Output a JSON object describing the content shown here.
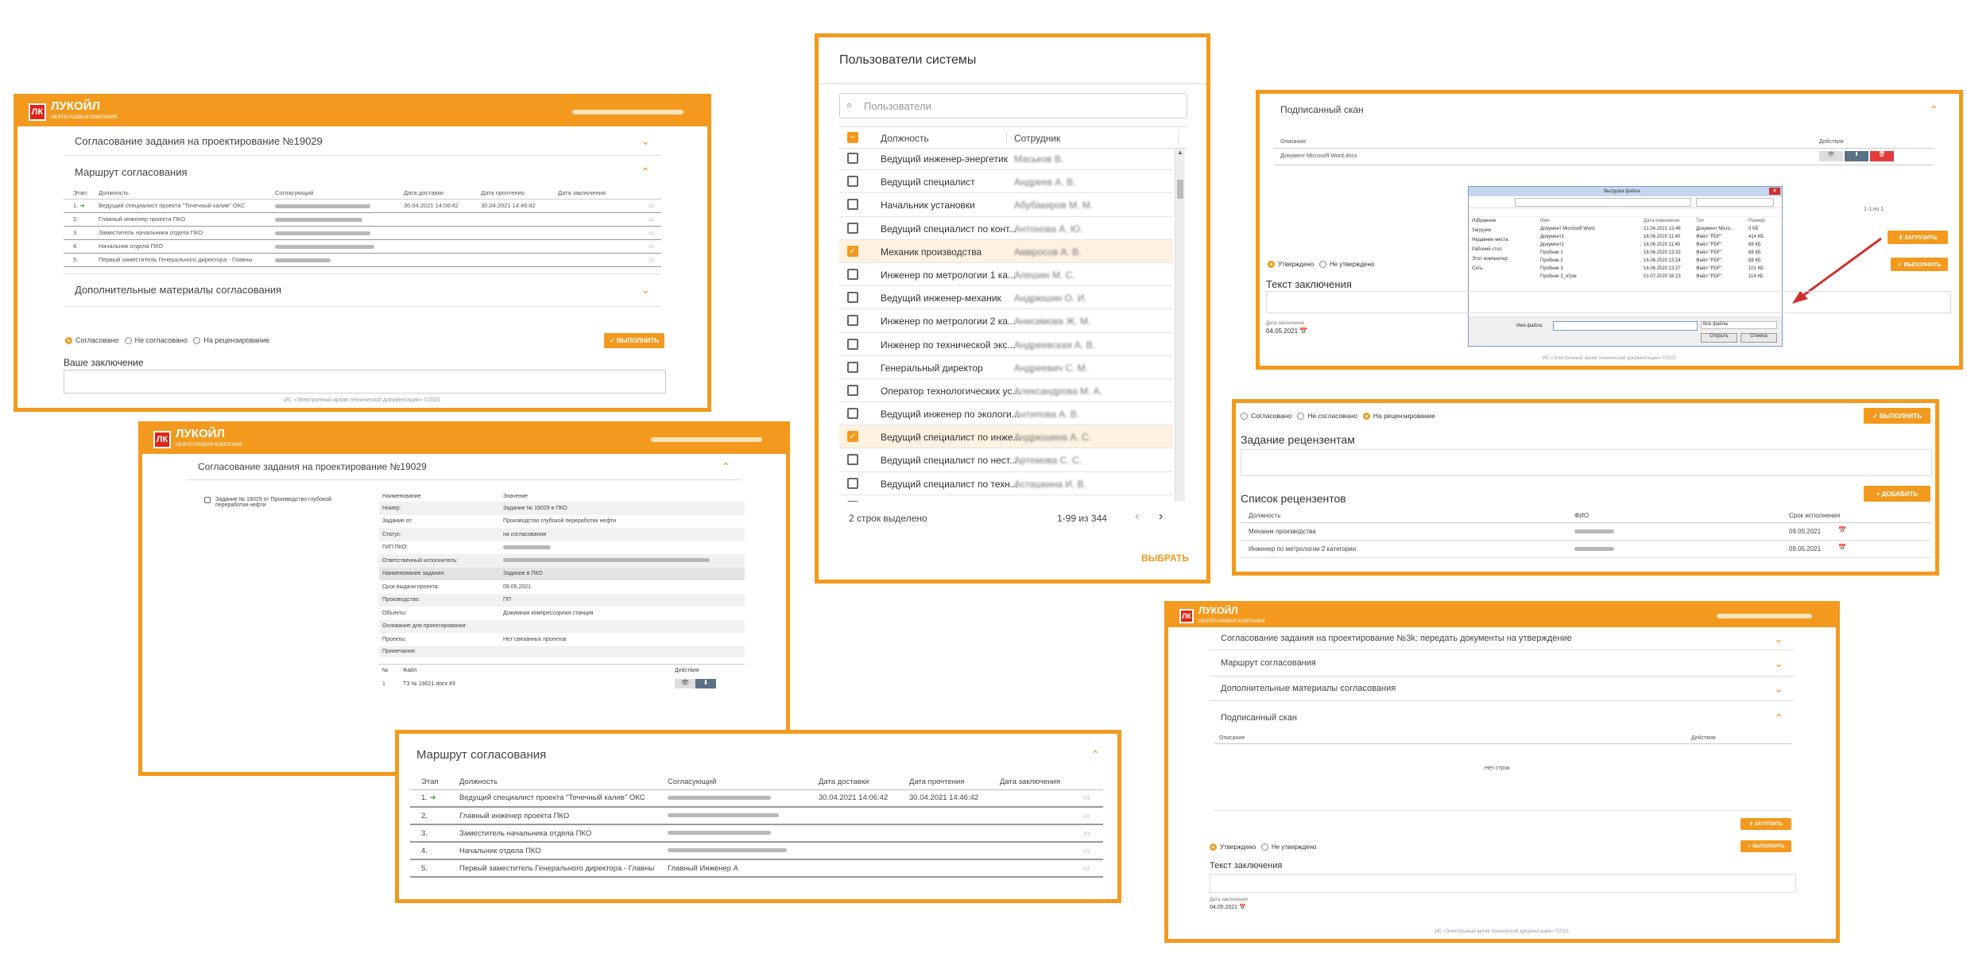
{
  "brand": {
    "name": "ЛУКОЙЛ",
    "sub": "НЕФТЕГАЗОВАЯ КОМПАНИЯ",
    "accent": "#f39a1e",
    "logo_red": "#e2231a"
  },
  "w1": {
    "task_title": "Согласование задания на проектирование №19029",
    "route_title": "Маршрут согласования",
    "headers": [
      "Этап",
      "Должность",
      "Согласующий",
      "Дата доставки",
      "Дата прочтения",
      "Дата заключения"
    ],
    "rows": [
      {
        "stage": "1.",
        "arrow": "➜",
        "position": "Ведущий специалист проекта \"Точечный калив\" ОКС",
        "delivered": "30.04.2021 14:06:42",
        "read": "30.04.2021 14:46:42"
      },
      {
        "stage": "2.",
        "position": "Главный инженер проекта ПКО"
      },
      {
        "stage": "3.",
        "position": "Заместитель начальника отдела ПКО"
      },
      {
        "stage": "4.",
        "position": "Начальник отдела ПКО"
      },
      {
        "stage": "5.",
        "position": "Первый заместитель Генерального директора - Главны"
      }
    ],
    "extra_title": "Дополнительные материалы согласования",
    "radios": [
      "Согласовано",
      "Не согласовано",
      "На рецензирование"
    ],
    "execute": "✓ ВЫПОЛНИТЬ",
    "conclusion": "Ваше заключение",
    "footer": "ИС «Электронный архив технической документации» ©2021"
  },
  "w2": {
    "title": "Согласование задания на проектирование №19029",
    "tree_item": "Задание № 19029 от Производство глубокой переработки нефти",
    "headers": [
      "Наименование",
      "Значение"
    ],
    "rows": [
      [
        "Номер:",
        "Задание № 19029 в ПКО"
      ],
      [
        "Задание от:",
        "Производство глубокой переработки нефти"
      ],
      [
        "Статус:",
        "на согласовании"
      ],
      [
        "ГИП ПКО:",
        ""
      ],
      [
        "Ответственный исполнитель:",
        ""
      ],
      [
        "Наименование задания:",
        "Задание в ПКО"
      ],
      [
        "Срок выдачи проекта:",
        "09.05.2021"
      ],
      [
        "Производство:",
        "ПП"
      ],
      [
        "Объекты:",
        "Дожимная компрессорная станция"
      ],
      [
        "Основание для проектирования:",
        ""
      ],
      [
        "Проекты:",
        "Нет связанных проектов"
      ],
      [
        "Примечания:",
        ""
      ]
    ],
    "file_headers": [
      "№",
      "Файл",
      "Действия"
    ],
    "file": {
      "num": "1",
      "name": "ТЗ № 19021.docx #3"
    }
  },
  "w3": {
    "title": "Маршрут согласования",
    "headers": [
      "Этап",
      "Должность",
      "Согласующий",
      "Дата доставки",
      "Дата прочтения",
      "Дата заключения"
    ],
    "rows": [
      {
        "stage": "1.",
        "arrow": "➜",
        "position": "Ведущий специалист проекта \"Точечный калив\" ОКС",
        "delivered": "30.04.2021 14:06:42",
        "read": "30.04.2021 14:46:42",
        "approver": ""
      },
      {
        "stage": "2.",
        "position": "Главный инженер проекта ПКО",
        "approver": ""
      },
      {
        "stage": "3.",
        "position": "Заместитель начальника отдела ПКО",
        "approver": ""
      },
      {
        "stage": "4.",
        "position": "Начальник отдела ПКО",
        "approver": ""
      },
      {
        "stage": "5.",
        "position": "Первый заместитель Генерального директора - Главны",
        "approver": "Главный Инженер А"
      }
    ]
  },
  "users": {
    "title": "Пользователи системы",
    "search_placeholder": "Пользователи",
    "headers": [
      "Должность",
      "Сотрудник"
    ],
    "rows": [
      {
        "pos": "Ведущий инженер-энергетик",
        "checked": false,
        "emp": "Маськов В."
      },
      {
        "pos": "Ведущий специалист",
        "checked": false,
        "emp": "Андреев А. В."
      },
      {
        "pos": "Начальник установки",
        "checked": false,
        "emp": "Абубакиров М. М."
      },
      {
        "pos": "Ведущий специалист по конт...",
        "checked": false,
        "emp": "Антонова А. Ю."
      },
      {
        "pos": "Механик производства",
        "checked": true,
        "emp": "Амвросов А. В."
      },
      {
        "pos": "Инженер по метрологии 1 ка...",
        "checked": false,
        "emp": "Алешин М. С."
      },
      {
        "pos": "Ведущий инженер-механик",
        "checked": false,
        "emp": "Андрюшин О. И."
      },
      {
        "pos": "Инженер по метрологии 2 ка...",
        "checked": false,
        "emp": "Анисимова Ж. М."
      },
      {
        "pos": "Инженер по технической экс...",
        "checked": false,
        "emp": "Андреевская А. В."
      },
      {
        "pos": "Генеральный директор",
        "checked": false,
        "emp": "Андреевич С. М."
      },
      {
        "pos": "Оператор технологических ус...",
        "checked": false,
        "emp": "Александрова М. А."
      },
      {
        "pos": "Ведущий инженер по экологи...",
        "checked": false,
        "emp": "Антипова А. В."
      },
      {
        "pos": "Ведущий специалист по инже...",
        "checked": true,
        "emp": "Андрюшина А. С."
      },
      {
        "pos": "Ведущий специалист по нест...",
        "checked": false,
        "emp": "Артемова С. С."
      },
      {
        "pos": "Ведущий специалист по техн...",
        "checked": false,
        "emp": "Асташкина И. В."
      },
      {
        "pos": "Ведущий инженер по техниче...",
        "checked": false,
        "emp": "Андреева М. В."
      }
    ],
    "selected": "2 строк выделено",
    "range": "1-99 из 344",
    "choose": "ВЫБРАТЬ"
  },
  "w5": {
    "title": "Подписанный скан",
    "headers": [
      "Описание",
      "Действия"
    ],
    "doc": "Документ Microsoft Word.docx",
    "pager": "1-1 из 1",
    "dialog_title": "Выгрузка файла",
    "dialog_files": [
      [
        "Документ Microsoft Word",
        "21.04.2021 13:46",
        "Документ Micro...",
        "0 КБ"
      ],
      [
        "Документ1",
        "16.06.2020 11:40",
        "Файл \"PDF\"",
        "414 КБ"
      ],
      [
        "Документ2",
        "16.06.2020 11:45",
        "Файл \"PDF\"",
        "88 КБ"
      ],
      [
        "Пробник 1",
        "16.06.2020 13:32",
        "Файл \"PDF\"",
        "88 КБ"
      ],
      [
        "Пробник 2",
        "16.06.2020 13:24",
        "Файл \"PDF\"",
        "88 КБ"
      ],
      [
        "Пробник 3",
        "16.06.2020 13:27",
        "Файл \"PDF\"",
        "101 КБ"
      ],
      [
        "Пробник 3_итрм",
        "01.07.2020 16:23",
        "Файл \"PDF\"",
        "114 КБ"
      ]
    ],
    "dialog_side": [
      "Избранное",
      "Загрузки",
      "Недавние места",
      "Рабочий стол",
      "Этот компьютер",
      "Сеть"
    ],
    "dialog_cols": [
      "Имя",
      "Дата изменения",
      "Тип",
      "Размер"
    ],
    "filename_label": "Имя файла:",
    "filter": "Все файлы",
    "open": "Открыть",
    "cancel": "Отмена",
    "upload": "⬆ ЗАГРУЗИТЬ",
    "radios": [
      "Утверждено",
      "Не утверждено"
    ],
    "execute": "✓ ВЫПОЛНИТЬ",
    "conclusion": "Текст заключения",
    "date_label": "Дата заключения",
    "date": "04.05.2021",
    "footer": "ИС «Электронный архив технической документации» ©2021"
  },
  "w6": {
    "radios": [
      "Согласовано",
      "Не согласовано",
      "На рецензирование"
    ],
    "execute": "✓ ВЫПОЛНИТЬ",
    "task": "Задание рецензентам",
    "add": "+ ДОБАВИТЬ",
    "list_title": "Список рецензентов",
    "headers": [
      "Должность",
      "ФИО",
      "Срок исполнения"
    ],
    "rows": [
      {
        "pos": "Механик производства",
        "date": "09.05.2021"
      },
      {
        "pos": "Инженер по метрологии 2 категории",
        "date": "09.05.2021"
      }
    ]
  },
  "w7": {
    "s1": "Согласование задания на проектирование №3k: передать документы на утверждение",
    "s2": "Маршрут согласования",
    "s3": "Дополнительные материалы согласования",
    "s4": "Подписанный скан",
    "headers": [
      "Описание",
      "Действия"
    ],
    "empty": "Нет строк",
    "upload": "⬆ ЗАГРУЗИТЬ",
    "radios": [
      "Утверждено",
      "Не утверждено"
    ],
    "execute": "✓ ВЫПОЛНИТЬ",
    "conclusion": "Текст заключения",
    "date_label": "Дата заключения",
    "date": "04.05.2021",
    "footer": "ИС «Электронный архив технической документации» ©2021"
  }
}
